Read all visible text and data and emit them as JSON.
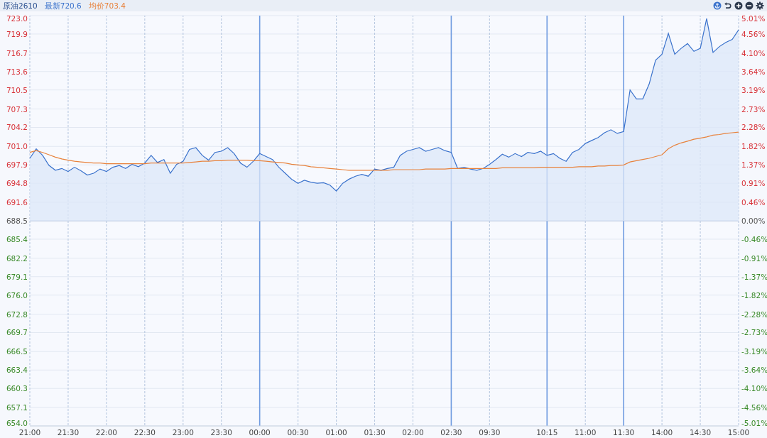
{
  "header": {
    "contract": "原油2610",
    "latest_value": "720.6",
    "average_value": "703.4"
  },
  "toolbar": [
    {
      "kind": "anchor"
    },
    {
      "kind": "undo"
    },
    {
      "kind": "zoom_in"
    },
    {
      "kind": "zoom_out"
    },
    {
      "kind": "settings"
    }
  ],
  "chart": {
    "chart_data": {
      "type": "line",
      "grid": true,
      "ref_lines": [
        {
          "axis": "y",
          "value": 688.5
        }
      ],
      "ylim": [
        654.0,
        723.0
      ],
      "categories": [
        "21:00",
        null,
        null,
        null,
        null,
        null,
        "21:30",
        null,
        null,
        null,
        null,
        null,
        "22:00",
        null,
        null,
        null,
        null,
        null,
        "22:30",
        null,
        null,
        null,
        null,
        null,
        "23:00",
        null,
        null,
        null,
        null,
        null,
        "23:30",
        null,
        null,
        null,
        null,
        null,
        "00:00",
        null,
        null,
        null,
        null,
        null,
        "00:30",
        null,
        null,
        null,
        null,
        null,
        "01:00",
        null,
        null,
        null,
        null,
        null,
        "01:30",
        null,
        null,
        null,
        null,
        null,
        "02:00",
        null,
        null,
        null,
        null,
        null,
        "02:30",
        null,
        null,
        null,
        null,
        null,
        "09:30",
        null,
        null,
        null,
        null,
        null,
        null,
        null,
        null,
        "10:15",
        null,
        null,
        null,
        null,
        null,
        "11:00",
        null,
        null,
        null,
        null,
        null,
        "11:30",
        null,
        null,
        null,
        null,
        null,
        "14:00",
        null,
        null,
        null,
        null,
        null,
        "14:30",
        null,
        null,
        null,
        null,
        null,
        "15:00"
      ],
      "series": [
        {
          "name": "最新",
          "color": "#3a72cc",
          "values": [
            699.0,
            700.6,
            699.5,
            697.8,
            697.0,
            697.3,
            696.8,
            697.5,
            696.9,
            696.2,
            696.5,
            697.2,
            696.8,
            697.5,
            697.8,
            697.3,
            698.0,
            697.6,
            698.2,
            699.5,
            698.3,
            698.8,
            696.5,
            698.0,
            698.5,
            700.5,
            700.8,
            699.5,
            698.7,
            700.0,
            700.2,
            700.8,
            699.8,
            698.2,
            697.5,
            698.5,
            699.8,
            699.3,
            698.8,
            697.5,
            696.5,
            695.5,
            694.8,
            695.3,
            695.0,
            694.8,
            694.9,
            694.5,
            693.5,
            694.8,
            695.5,
            696.0,
            696.3,
            696.0,
            697.2,
            697.0,
            697.3,
            697.5,
            699.5,
            700.2,
            700.5,
            700.8,
            700.2,
            700.5,
            700.8,
            700.3,
            700.0,
            697.3,
            697.5,
            697.2,
            697.0,
            697.3,
            698.0,
            698.8,
            699.7,
            699.2,
            699.8,
            699.3,
            700.0,
            699.8,
            700.2,
            699.5,
            699.8,
            699.0,
            698.5,
            700.0,
            700.5,
            701.5,
            702.0,
            702.5,
            703.3,
            703.8,
            703.2,
            703.5,
            710.5,
            709.0,
            709.0,
            711.5,
            715.5,
            716.5,
            720.0,
            716.5,
            717.5,
            718.3,
            717.0,
            717.5,
            722.5,
            716.8,
            717.8,
            718.5,
            719.0,
            720.6
          ]
        },
        {
          "name": "均价",
          "color": "#e8823c",
          "values": [
            700.0,
            700.3,
            700.0,
            699.6,
            699.2,
            698.9,
            698.7,
            698.5,
            698.4,
            698.3,
            698.2,
            698.2,
            698.1,
            698.1,
            698.1,
            698.1,
            698.1,
            698.1,
            698.1,
            698.2,
            698.2,
            698.2,
            698.2,
            698.2,
            698.2,
            698.3,
            698.4,
            698.5,
            698.5,
            698.6,
            698.6,
            698.7,
            698.7,
            698.7,
            698.7,
            698.6,
            698.6,
            698.5,
            698.4,
            698.3,
            698.2,
            698.0,
            697.9,
            697.8,
            697.6,
            697.5,
            697.4,
            697.3,
            697.2,
            697.1,
            697.0,
            697.0,
            697.0,
            697.0,
            697.0,
            697.0,
            697.0,
            697.1,
            697.1,
            697.1,
            697.1,
            697.1,
            697.2,
            697.2,
            697.2,
            697.2,
            697.3,
            697.3,
            697.3,
            697.3,
            697.3,
            697.3,
            697.3,
            697.3,
            697.4,
            697.4,
            697.4,
            697.4,
            697.4,
            697.4,
            697.5,
            697.5,
            697.5,
            697.5,
            697.5,
            697.5,
            697.6,
            697.6,
            697.6,
            697.7,
            697.7,
            697.8,
            697.8,
            697.9,
            698.4,
            698.6,
            698.8,
            699.0,
            699.3,
            699.6,
            700.6,
            701.2,
            701.6,
            701.9,
            702.2,
            702.4,
            702.6,
            702.9,
            703.0,
            703.2,
            703.3,
            703.4
          ]
        }
      ],
      "yticks": [
        {
          "value": 723.0,
          "label": "723.0"
        },
        {
          "value": 719.9,
          "label": "719.9"
        },
        {
          "value": 716.7,
          "label": "716.7"
        },
        {
          "value": 713.6,
          "label": "713.6"
        },
        {
          "value": 710.5,
          "label": "710.5"
        },
        {
          "value": 707.3,
          "label": "707.3"
        },
        {
          "value": 704.2,
          "label": "704.2"
        },
        {
          "value": 701.0,
          "label": "701.0"
        },
        {
          "value": 697.9,
          "label": "697.9"
        },
        {
          "value": 694.8,
          "label": "694.8"
        },
        {
          "value": 691.6,
          "label": "691.6"
        },
        {
          "value": 688.5,
          "label": "688.5"
        },
        {
          "value": 685.4,
          "label": "685.4"
        },
        {
          "value": 682.2,
          "label": "682.2"
        },
        {
          "value": 679.1,
          "label": "679.1"
        },
        {
          "value": 676.0,
          "label": "676.0"
        },
        {
          "value": 672.8,
          "label": "672.8"
        },
        {
          "value": 669.7,
          "label": "669.7"
        },
        {
          "value": 666.5,
          "label": "666.5"
        },
        {
          "value": 663.4,
          "label": "663.4"
        },
        {
          "value": 660.3,
          "label": "660.3"
        },
        {
          "value": 657.1,
          "label": "657.1"
        },
        {
          "value": 654.0,
          "label": "654.0"
        }
      ]
    },
    "right_axis_labels": [
      "5.01%",
      "4.56%",
      "4.10%",
      "3.64%",
      "3.19%",
      "2.73%",
      "2.28%",
      "1.82%",
      "1.37%",
      "0.91%",
      "0.46%",
      "0.00%",
      "-0.46%",
      "-0.91%",
      "-1.37%",
      "-1.82%",
      "-2.28%",
      "-2.73%",
      "-3.19%",
      "-3.64%",
      "-4.10%",
      "-4.56%",
      "-5.01%"
    ],
    "time_grid_lines": [
      {
        "solid": false
      },
      {
        "solid": false
      },
      {
        "solid": false
      },
      {
        "solid": false
      },
      {
        "solid": false
      },
      {
        "solid": false
      },
      {
        "solid": true
      },
      {
        "solid": false
      },
      {
        "solid": false
      },
      {
        "solid": false
      },
      {
        "solid": false
      },
      {
        "solid": true
      },
      {
        "solid": false
      },
      {
        "solid": true
      },
      {
        "solid": false
      },
      {
        "solid": true
      },
      {
        "solid": false
      },
      {
        "solid": false
      },
      {
        "solid": false
      }
    ]
  }
}
